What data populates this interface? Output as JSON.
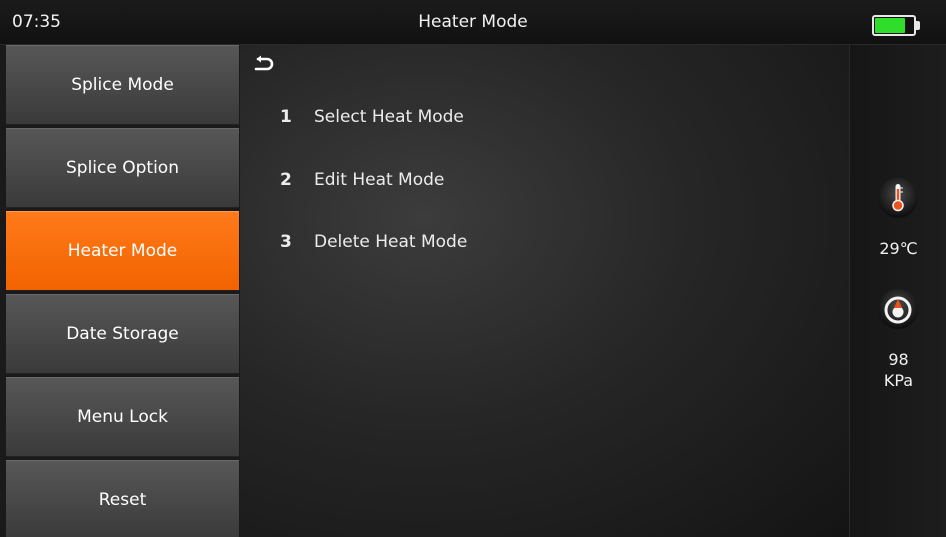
{
  "status_bar": {
    "time": "07:35",
    "title": "Heater Mode",
    "battery_level": 0.78,
    "battery_color": "#2ede2b"
  },
  "sidebar": {
    "items": [
      {
        "label": "Splice Mode",
        "active": false
      },
      {
        "label": "Splice Option",
        "active": false
      },
      {
        "label": "Heater Mode",
        "active": true
      },
      {
        "label": "Date Storage",
        "active": false
      },
      {
        "label": "Menu Lock",
        "active": false
      },
      {
        "label": "Reset",
        "active": false
      }
    ],
    "active_color": "#f26300"
  },
  "main": {
    "back_icon": "return-arrow-icon",
    "items": [
      {
        "num": "1",
        "label": "Select Heat Mode"
      },
      {
        "num": "2",
        "label": "Edit Heat Mode"
      },
      {
        "num": "3",
        "label": "Delete Heat Mode"
      }
    ]
  },
  "status_panel": {
    "temperature": {
      "icon": "thermometer-icon",
      "value": "29℃"
    },
    "pressure": {
      "icon": "pressure-gauge-icon",
      "value": "98",
      "unit": "KPa"
    }
  }
}
